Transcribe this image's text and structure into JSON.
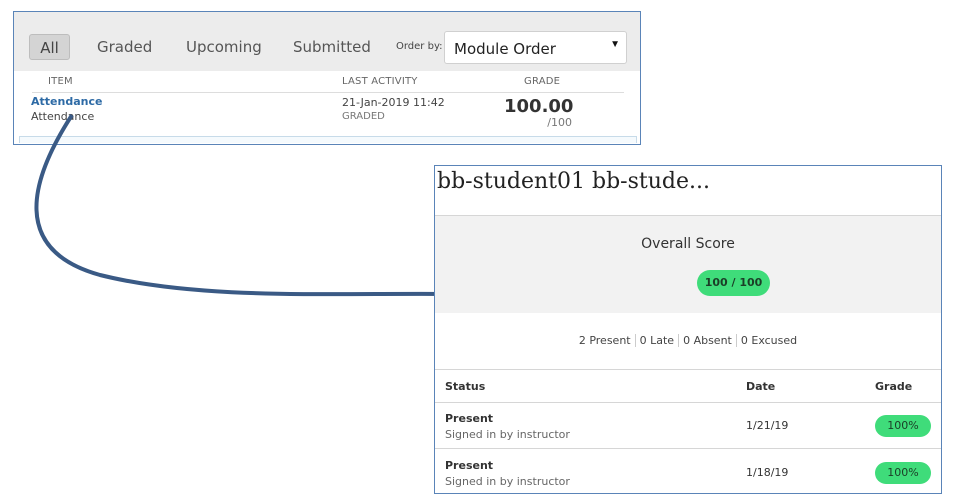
{
  "grades_panel": {
    "filters": {
      "all": "All",
      "graded": "Graded",
      "upcoming": "Upcoming",
      "submitted": "Submitted"
    },
    "order_by": {
      "label": "Order by:",
      "selected": "Module Order"
    },
    "columns": {
      "item": "ITEM",
      "last_activity": "LAST ACTIVITY",
      "grade": "GRADE"
    },
    "row": {
      "item_title": "Attendance",
      "item_subtitle": "Attendance",
      "activity_date": "21-Jan-2019 11:42",
      "activity_status": "GRADED",
      "grade": "100.00",
      "grade_max": "/100"
    }
  },
  "detail_panel": {
    "student_name": "bb-student01 bb-stude...",
    "overall_title": "Overall Score",
    "overall_score": "100 / 100",
    "counts": {
      "present": "2 Present",
      "late": "0 Late",
      "absent": "0 Absent",
      "excused": "0 Excused"
    },
    "columns": {
      "status": "Status",
      "date": "Date",
      "grade": "Grade"
    },
    "rows": [
      {
        "status": "Present",
        "detail": "Signed in by instructor",
        "date": "1/21/19",
        "grade": "100%"
      },
      {
        "status": "Present",
        "detail": "Signed in by instructor",
        "date": "1/18/19",
        "grade": "100%"
      }
    ]
  },
  "colors": {
    "panel_border": "#5a84b8",
    "arrow": "#3a5a85",
    "link": "#2d6aa5",
    "pill_green": "#3fdc7a"
  }
}
